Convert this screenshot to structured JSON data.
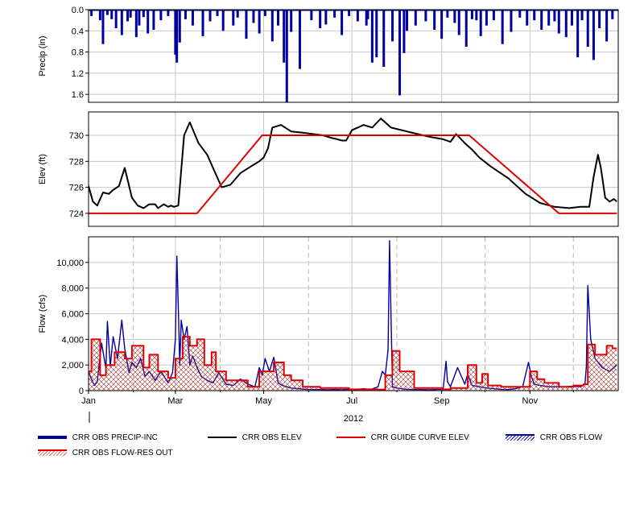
{
  "chart_data": [
    {
      "type": "bar",
      "ylabel": "Precip (in)",
      "ylim": [
        0,
        1.75
      ],
      "y_inverted": true,
      "yticks": [
        "0.0",
        "0.4",
        "0.8",
        "1.2",
        "1.6"
      ],
      "ytick_values": [
        0,
        0.4,
        0.8,
        1.2,
        1.6
      ],
      "grid": true,
      "series": [
        {
          "name": "CRR OBS PRECIP-INC",
          "color": "#0000a0",
          "day": [
            2,
            8,
            10,
            13,
            16,
            19,
            23,
            27,
            29,
            33,
            35,
            38,
            41,
            45,
            50,
            55,
            60,
            61,
            63,
            67,
            72,
            79,
            84,
            89,
            93,
            100,
            103,
            109,
            114,
            118,
            122,
            127,
            131,
            135,
            137,
            140,
            146,
            154,
            160,
            164,
            170,
            175,
            180,
            186,
            192,
            193,
            196,
            199,
            204,
            210,
            215,
            218,
            220,
            226,
            233,
            239,
            244,
            248,
            253,
            256,
            261,
            265,
            268,
            271,
            275,
            280,
            286,
            292,
            298,
            303,
            308,
            313,
            318,
            322,
            325,
            330,
            334,
            338,
            341,
            345,
            349,
            353,
            358,
            362
          ],
          "value": [
            0.12,
            0.2,
            0.65,
            0.1,
            0.18,
            0.35,
            0.48,
            0.22,
            0.15,
            0.52,
            0.3,
            0.14,
            0.45,
            0.38,
            0.2,
            0.12,
            0.85,
            1.0,
            0.62,
            0.18,
            0.3,
            0.5,
            0.22,
            0.12,
            0.4,
            0.3,
            0.15,
            0.55,
            0.25,
            0.45,
            0.12,
            0.6,
            0.3,
            1.0,
            1.78,
            0.42,
            1.12,
            0.2,
            0.35,
            0.28,
            0.15,
            0.48,
            0.12,
            0.22,
            0.3,
            0.18,
            1.0,
            0.9,
            1.08,
            0.6,
            1.62,
            0.82,
            0.4,
            0.3,
            0.22,
            0.38,
            0.55,
            0.15,
            0.25,
            0.48,
            0.7,
            0.18,
            0.2,
            0.5,
            0.3,
            0.2,
            0.65,
            0.42,
            0.15,
            0.3,
            0.2,
            0.38,
            0.3,
            0.22,
            0.45,
            0.52,
            0.3,
            0.9,
            0.2,
            0.7,
            0.95,
            0.35,
            0.6,
            0.18
          ]
        }
      ]
    },
    {
      "type": "line",
      "ylabel": "Elev (ft)",
      "ylim": [
        723,
        731.8
      ],
      "yticks": [
        "724",
        "726",
        "728",
        "730"
      ],
      "ytick_values": [
        724,
        726,
        728,
        730
      ],
      "grid": true,
      "series": [
        {
          "name": "CRR OBS ELEV",
          "color": "#000000",
          "day": [
            0,
            3,
            6,
            10,
            14,
            17,
            21,
            25,
            30,
            34,
            38,
            42,
            46,
            48,
            52,
            55,
            57,
            59,
            62,
            66,
            70,
            76,
            82,
            88,
            92,
            98,
            105,
            112,
            118,
            121,
            124,
            127,
            133,
            140,
            148,
            155,
            162,
            168,
            172,
            175,
            178,
            182,
            186,
            190,
            196,
            202,
            209,
            220,
            235,
            245,
            250,
            254,
            260,
            265,
            270,
            278,
            290,
            302,
            312,
            322,
            332,
            340,
            346,
            349,
            352,
            354,
            357,
            360,
            363,
            365
          ],
          "value": [
            726.1,
            724.9,
            724.6,
            725.6,
            725.5,
            725.8,
            726.1,
            727.5,
            725.2,
            724.6,
            724.4,
            724.7,
            724.7,
            724.4,
            724.7,
            724.5,
            724.6,
            724.5,
            724.6,
            730.0,
            731.0,
            729.4,
            728.5,
            727.0,
            726.0,
            726.2,
            727.1,
            727.6,
            728.0,
            728.3,
            729.0,
            730.6,
            730.8,
            730.3,
            730.2,
            730.1,
            730.0,
            729.8,
            729.7,
            729.6,
            729.6,
            730.4,
            730.6,
            730.8,
            730.6,
            731.3,
            730.6,
            730.3,
            729.9,
            729.7,
            729.5,
            730.1,
            729.4,
            728.9,
            728.3,
            727.6,
            726.7,
            725.5,
            724.8,
            724.5,
            724.4,
            724.5,
            724.5,
            726.8,
            728.5,
            727.5,
            725.2,
            724.9,
            725.1,
            724.9
          ]
        },
        {
          "name": "CRR GUIDE CURVE ELEV",
          "color": "#e00000",
          "day": [
            0,
            75,
            120,
            263,
            325,
            365
          ],
          "value": [
            724,
            724,
            730,
            730,
            724,
            724
          ]
        }
      ]
    },
    {
      "type": "line",
      "ylabel": "Flow (cfs)",
      "xlabel": "2012",
      "ylim": [
        0,
        12000
      ],
      "yticks": [
        "0",
        "2,000",
        "4,000",
        "6,000",
        "8,000",
        "10,000"
      ],
      "ytick_values": [
        0,
        2000,
        4000,
        6000,
        8000,
        10000
      ],
      "xticks": [
        "Jan",
        "Mar",
        "May",
        "Jul",
        "Sep",
        "Nov"
      ],
      "xtick_days": [
        0,
        60,
        121,
        182,
        244,
        305
      ],
      "grid": true,
      "series": [
        {
          "name": "CRR OBS FLOW",
          "color": "#0000a0",
          "day": [
            0,
            2,
            4,
            6,
            9,
            12,
            13,
            15,
            17,
            20,
            23,
            25,
            28,
            30,
            33,
            36,
            39,
            42,
            46,
            50,
            55,
            58,
            60,
            61,
            62,
            63,
            64,
            66,
            68,
            70,
            72,
            75,
            78,
            82,
            86,
            90,
            95,
            100,
            105,
            110,
            115,
            118,
            120,
            122,
            125,
            128,
            131,
            134,
            137,
            140,
            145,
            150,
            155,
            160,
            165,
            170,
            175,
            180,
            185,
            190,
            195,
            200,
            203,
            205,
            207,
            208,
            210,
            213,
            216,
            220,
            225,
            230,
            235,
            240,
            245,
            247,
            248,
            250,
            255,
            260,
            262,
            265,
            270,
            275,
            280,
            285,
            290,
            295,
            300,
            304,
            306,
            308,
            312,
            318,
            323,
            330,
            335,
            340,
            343,
            344,
            345,
            347,
            350,
            355,
            360,
            365
          ],
          "value": [
            1500,
            900,
            400,
            700,
            3700,
            1700,
            5400,
            1900,
            4200,
            2500,
            5500,
            3300,
            1400,
            2200,
            1800,
            2500,
            1100,
            1500,
            800,
            1500,
            600,
            1400,
            4000,
            10500,
            6500,
            2000,
            5500,
            4000,
            5000,
            2000,
            2700,
            1800,
            1100,
            800,
            600,
            1400,
            500,
            400,
            900,
            500,
            300,
            1800,
            1200,
            2500,
            1500,
            2600,
            600,
            400,
            300,
            200,
            150,
            100,
            80,
            80,
            60,
            80,
            60,
            100,
            80,
            150,
            80,
            300,
            1500,
            1200,
            3200,
            11700,
            300,
            200,
            150,
            100,
            80,
            80,
            60,
            80,
            100,
            2300,
            700,
            300,
            1800,
            500,
            1300,
            400,
            300,
            200,
            150,
            100,
            80,
            150,
            300,
            2200,
            1100,
            500,
            400,
            300,
            300,
            300,
            350,
            300,
            500,
            1900,
            8200,
            4000,
            2500,
            1800,
            1500,
            2000
          ]
        },
        {
          "name": "CRR OBS FLOW-RES OUT",
          "color": "#e00000",
          "day": [
            0,
            2,
            2,
            8,
            8,
            12,
            12,
            18,
            18,
            25,
            25,
            30,
            30,
            38,
            38,
            42,
            42,
            48,
            48,
            55,
            55,
            60,
            60,
            65,
            65,
            70,
            70,
            75,
            75,
            80,
            80,
            85,
            85,
            88,
            88,
            95,
            95,
            110,
            110,
            118,
            118,
            128,
            128,
            135,
            135,
            140,
            140,
            148,
            148,
            160,
            160,
            180,
            180,
            200,
            200,
            205,
            205,
            210,
            210,
            215,
            215,
            225,
            225,
            245,
            245,
            250,
            250,
            262,
            262,
            268,
            268,
            272,
            272,
            276,
            276,
            285,
            285,
            300,
            300,
            305,
            305,
            310,
            310,
            315,
            315,
            325,
            325,
            335,
            335,
            342,
            342,
            345,
            345,
            350,
            350,
            358,
            358,
            362,
            362,
            365
          ],
          "value": [
            1500,
            1500,
            4000,
            4000,
            1200,
            1200,
            2000,
            2000,
            3000,
            3000,
            2500,
            2500,
            3500,
            3500,
            1800,
            1800,
            2800,
            2800,
            1500,
            1500,
            1000,
            1000,
            2500,
            2500,
            4200,
            4200,
            3500,
            3500,
            4000,
            4000,
            2000,
            2000,
            3000,
            3000,
            1500,
            1500,
            800,
            800,
            300,
            300,
            1500,
            1500,
            2200,
            2200,
            1200,
            1200,
            800,
            800,
            300,
            300,
            200,
            200,
            100,
            100,
            80,
            80,
            1200,
            1200,
            3100,
            3100,
            1500,
            1500,
            200,
            200,
            100,
            100,
            200,
            200,
            2000,
            2000,
            600,
            600,
            1300,
            1300,
            400,
            400,
            300,
            300,
            300,
            300,
            1500,
            1500,
            900,
            900,
            600,
            600,
            300,
            300,
            400,
            400,
            500,
            500,
            3600,
            3600,
            2800,
            2800,
            3500,
            3500,
            3300,
            3300
          ]
        }
      ]
    }
  ],
  "legend": {
    "items": [
      {
        "label": "CRR OBS PRECIP-INC",
        "color": "#0000a0",
        "style": "thick"
      },
      {
        "label": "CRR OBS ELEV",
        "color": "#000000",
        "style": "line"
      },
      {
        "label": "CRR GUIDE CURVE ELEV",
        "color": "#e00000",
        "style": "line"
      },
      {
        "label": "CRR OBS FLOW",
        "color": "#0000a0",
        "style": "hatch"
      },
      {
        "label": "CRR OBS FLOW-RES OUT",
        "color": "#e00000",
        "style": "hatch"
      }
    ]
  }
}
